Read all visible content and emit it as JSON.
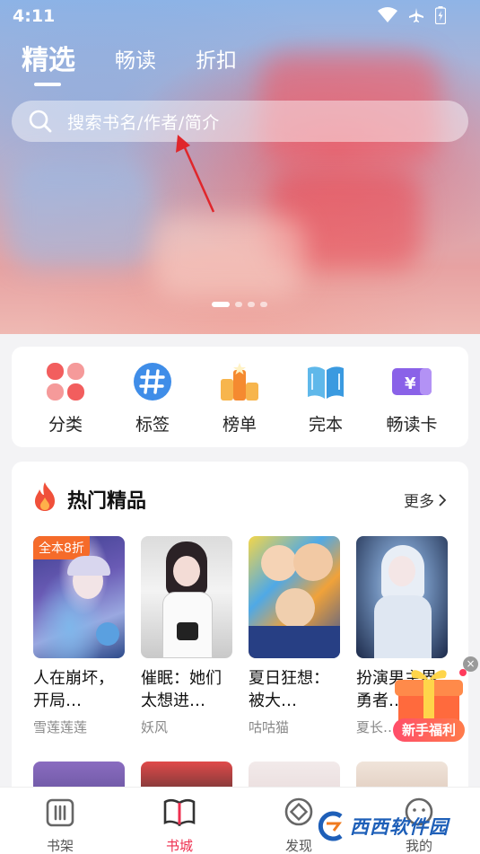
{
  "status_bar": {
    "time": "4:11"
  },
  "top_tabs": [
    {
      "label": "精选",
      "active": true
    },
    {
      "label": "畅读",
      "active": false
    },
    {
      "label": "折扣",
      "active": false
    }
  ],
  "search": {
    "placeholder": "搜索书名/作者/简介"
  },
  "banner": {
    "page_count": 4,
    "active_page": 1
  },
  "categories": [
    {
      "label": "分类",
      "icon": "clover-grid-icon"
    },
    {
      "label": "标签",
      "icon": "hashtag-icon"
    },
    {
      "label": "榜单",
      "icon": "ranking-icon"
    },
    {
      "label": "完本",
      "icon": "open-book-icon"
    },
    {
      "label": "畅读卡",
      "icon": "yen-ticket-icon"
    }
  ],
  "hot_section": {
    "title": "热门精品",
    "more_label": "更多",
    "books": [
      {
        "badge": "全本8折",
        "title": "人在崩坏，开局…",
        "author": "雪莲莲莲"
      },
      {
        "badge": "",
        "title": "催眠：她们太想进…",
        "author": "妖风"
      },
      {
        "badge": "",
        "title": "夏日狂想：被大…",
        "author": "咕咕猫"
      },
      {
        "badge": "",
        "title": "扮演男主界勇者…",
        "author": "夏长…"
      }
    ]
  },
  "gift": {
    "label": "新手福利",
    "close": "×"
  },
  "bottom_nav": [
    {
      "label": "书架",
      "active": false
    },
    {
      "label": "书城",
      "active": true
    },
    {
      "label": "发现",
      "active": false
    },
    {
      "label": "我的",
      "active": false
    }
  ],
  "watermark": {
    "text": "西西软件园",
    "sub": "CR173.COM"
  },
  "colors": {
    "accent": "#ee2f4f",
    "badge": "#f56b2a"
  }
}
